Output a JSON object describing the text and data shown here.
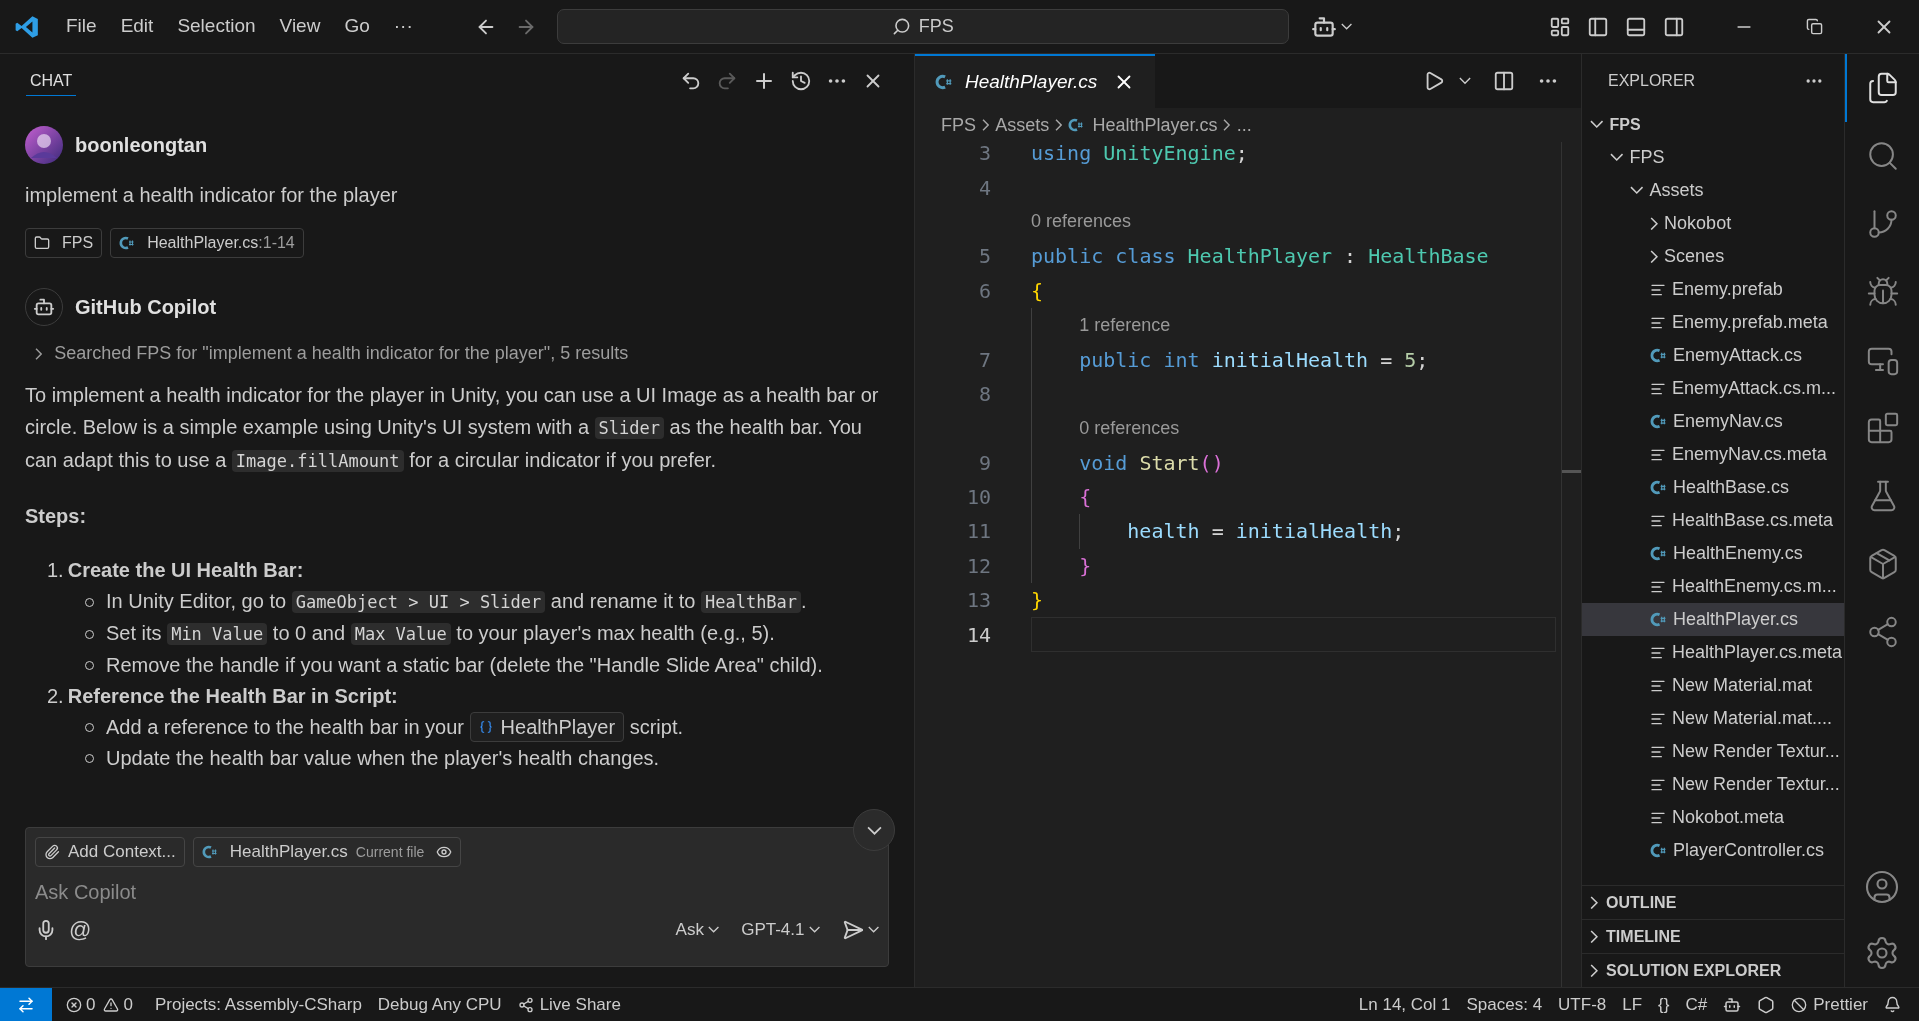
{
  "menu": [
    "File",
    "Edit",
    "Selection",
    "View",
    "Go",
    "···"
  ],
  "command_center": {
    "value": "FPS"
  },
  "chat": {
    "tab": {
      "label": "CHAT",
      "selected": true
    },
    "user": {
      "name": "boonleongtan",
      "message": "implement a health indicator for the player",
      "chips": [
        {
          "kind": "folder",
          "label": "FPS"
        },
        {
          "kind": "csharp",
          "label": "HealthPlayer.cs",
          "range": ":1-14"
        }
      ]
    },
    "assistant": {
      "name": "GitHub Copilot",
      "search_note": {
        "text": "Searched FPS for \"implement a health indicator for the player\", 5 results",
        "expanded": false
      },
      "paragraph": [
        {
          "kind": "text",
          "text": "To implement a health indicator for the player in Unity, you can use a UI Image as a health bar or circle. Below is a simple example using Unity's UI system with a "
        },
        {
          "kind": "code",
          "text": "Slider"
        },
        {
          "kind": "text",
          "text": " as the health bar. You can adapt this to use a "
        },
        {
          "kind": "code",
          "text": "Image.fillAmount"
        },
        {
          "kind": "text",
          "text": " for a circular indicator if you prefer."
        }
      ],
      "heading": "Steps:",
      "steps": [
        {
          "number": "1.",
          "title": "Create the UI Health Bar:",
          "bullets": [
            [
              {
                "kind": "text",
                "text": "In Unity Editor, go to "
              },
              {
                "kind": "code",
                "text": "GameObject > UI > Slider"
              },
              {
                "kind": "text",
                "text": " and rename it to "
              },
              {
                "kind": "code",
                "text": "HealthBar"
              },
              {
                "kind": "text",
                "text": "."
              }
            ],
            [
              {
                "kind": "text",
                "text": "Set its "
              },
              {
                "kind": "code",
                "text": "Min Value"
              },
              {
                "kind": "text",
                "text": " to 0 and "
              },
              {
                "kind": "code",
                "text": "Max Value"
              },
              {
                "kind": "text",
                "text": " to your player's max health (e.g., 5)."
              }
            ],
            [
              {
                "kind": "text",
                "text": "Remove the handle if you want a static bar (delete the \"Handle Slide Area\" child)."
              }
            ]
          ]
        },
        {
          "number": "2.",
          "title": "Reference the Health Bar in Script:",
          "bullets": [
            [
              {
                "kind": "text",
                "text": "Add a reference to the health bar in your "
              },
              {
                "kind": "symbol",
                "text": "HealthPlayer"
              },
              {
                "kind": "text",
                "text": " script."
              }
            ],
            [
              {
                "kind": "text",
                "text": "Update the health bar value when the player's health changes."
              }
            ]
          ]
        }
      ]
    },
    "input": {
      "add_context": "Add Context...",
      "file_chip": {
        "name": "HealthPlayer.cs",
        "note": "Current file"
      },
      "placeholder": "Ask Copilot",
      "at": "@",
      "mode": "Ask",
      "model": "GPT-4.1"
    }
  },
  "editor": {
    "tab": {
      "label": "HealthPlayer.cs",
      "selected": true
    },
    "breadcrumb": [
      {
        "kind": "text",
        "label": "FPS"
      },
      {
        "kind": "text",
        "label": "Assets"
      },
      {
        "kind": "csharp",
        "label": "HealthPlayer.cs"
      },
      {
        "kind": "text",
        "label": "..."
      }
    ],
    "lines": [
      {
        "number": "3",
        "current": false,
        "tokens": [
          {
            "kind": "keyword",
            "t": "using"
          },
          {
            "kind": "type",
            "t": "UnityEngine",
            "glue": false
          },
          {
            "kind": "punct",
            "t": ";",
            "glue": true
          }
        ]
      },
      {
        "number": "4",
        "current": false
      },
      {
        "number": "5",
        "current": false,
        "lens": "0 references",
        "tokens": [
          {
            "kind": "keyword",
            "t": "public"
          },
          {
            "kind": "keyword",
            "t": "class",
            "glue": false
          },
          {
            "kind": "type",
            "t": "HealthPlayer",
            "glue": false
          },
          {
            "kind": "punct",
            "t": ":",
            "glue": false
          },
          {
            "kind": "type",
            "t": "HealthBase",
            "glue": false
          }
        ]
      },
      {
        "number": "6",
        "current": false,
        "tokens": [
          {
            "kind": "open-brace1",
            "t": "{"
          }
        ]
      },
      {
        "number": "7",
        "current": false,
        "lens": "1 reference",
        "tokens": [
          {
            "kind": "keyword",
            "t": "public"
          },
          {
            "kind": "keyword",
            "t": "int",
            "glue": false
          },
          {
            "kind": "ident",
            "t": "initialHealth",
            "glue": false
          },
          {
            "kind": "punct",
            "t": "=",
            "glue": false
          },
          {
            "kind": "number",
            "t": "5",
            "glue": false
          },
          {
            "kind": "punct",
            "t": ";",
            "glue": true
          }
        ]
      },
      {
        "number": "8",
        "current": false
      },
      {
        "number": "9",
        "current": false,
        "lens": "0 references",
        "tokens": [
          {
            "kind": "keyword",
            "t": "void"
          },
          {
            "kind": "method",
            "t": "Start",
            "glue": false
          },
          {
            "kind": "paren2",
            "t": "()",
            "glue": true
          }
        ]
      },
      {
        "number": "10",
        "current": false,
        "tokens": [
          {
            "kind": "open-brace2",
            "t": "{"
          }
        ]
      },
      {
        "number": "11",
        "current": false,
        "tokens": [
          {
            "kind": "ident",
            "t": "health"
          },
          {
            "kind": "punct",
            "t": "=",
            "glue": false
          },
          {
            "kind": "ident",
            "t": "initialHealth",
            "glue": false
          },
          {
            "kind": "punct",
            "t": ";",
            "glue": true
          }
        ]
      },
      {
        "number": "12",
        "current": false,
        "tokens": [
          {
            "kind": "close-brace2",
            "t": "}"
          }
        ]
      },
      {
        "number": "13",
        "current": false,
        "tokens": [
          {
            "kind": "close-brace1",
            "t": "}"
          }
        ]
      },
      {
        "number": "14",
        "current": true
      }
    ]
  },
  "explorer": {
    "title": "EXPLORER",
    "tree": [
      {
        "label": "FPS",
        "kind": "root",
        "expanded": true,
        "selected": false,
        "children": [
          {
            "label": "FPS",
            "kind": "folder",
            "expanded": true,
            "selected": false,
            "children": [
              {
                "label": "Assets",
                "kind": "folder",
                "expanded": true,
                "selected": false,
                "children": [
                  {
                    "label": "Nokobot",
                    "kind": "folder",
                    "expanded": false,
                    "selected": false
                  },
                  {
                    "label": "Scenes",
                    "kind": "folder",
                    "expanded": false,
                    "selected": false
                  },
                  {
                    "label": "Enemy.prefab",
                    "kind": "text",
                    "selected": false
                  },
                  {
                    "label": "Enemy.prefab.meta",
                    "kind": "text",
                    "selected": false
                  },
                  {
                    "label": "EnemyAttack.cs",
                    "kind": "csharp",
                    "selected": false
                  },
                  {
                    "label": "EnemyAttack.cs.m...",
                    "kind": "text",
                    "selected": false
                  },
                  {
                    "label": "EnemyNav.cs",
                    "kind": "csharp",
                    "selected": false
                  },
                  {
                    "label": "EnemyNav.cs.meta",
                    "kind": "text",
                    "selected": false
                  },
                  {
                    "label": "HealthBase.cs",
                    "kind": "csharp",
                    "selected": false
                  },
                  {
                    "label": "HealthBase.cs.meta",
                    "kind": "text",
                    "selected": false
                  },
                  {
                    "label": "HealthEnemy.cs",
                    "kind": "csharp",
                    "selected": false
                  },
                  {
                    "label": "HealthEnemy.cs.m...",
                    "kind": "text",
                    "selected": false
                  },
                  {
                    "label": "HealthPlayer.cs",
                    "kind": "csharp",
                    "selected": true
                  },
                  {
                    "label": "HealthPlayer.cs.meta",
                    "kind": "text",
                    "selected": false
                  },
                  {
                    "label": "New Material.mat",
                    "kind": "text",
                    "selected": false
                  },
                  {
                    "label": "New Material.mat....",
                    "kind": "text",
                    "selected": false
                  },
                  {
                    "label": "New Render Textur...",
                    "kind": "text",
                    "selected": false
                  },
                  {
                    "label": "New Render Textur...",
                    "kind": "text",
                    "selected": false
                  },
                  {
                    "label": "Nokobot.meta",
                    "kind": "text",
                    "selected": false
                  },
                  {
                    "label": "PlayerController.cs",
                    "kind": "csharp",
                    "selected": false
                  }
                ]
              }
            ]
          }
        ]
      }
    ],
    "sections": [
      {
        "label": "OUTLINE",
        "expanded": false
      },
      {
        "label": "TIMELINE",
        "expanded": false
      },
      {
        "label": "SOLUTION EXPLORER",
        "expanded": false
      }
    ]
  },
  "activity_bar": [
    {
      "kind": "explorer",
      "selected": true
    },
    {
      "kind": "search",
      "selected": false
    },
    {
      "kind": "source-control",
      "selected": false
    },
    {
      "kind": "run-debug",
      "selected": false
    },
    {
      "kind": "remote",
      "selected": false
    },
    {
      "kind": "extensions",
      "selected": false
    },
    {
      "kind": "testing",
      "selected": false
    },
    {
      "kind": "package",
      "selected": false
    },
    {
      "kind": "share",
      "selected": false
    }
  ],
  "status_bar": {
    "errors": "0",
    "warnings": "0",
    "left": [
      {
        "kind": "plain",
        "label": "Projects: Assembly-CSharp"
      },
      {
        "kind": "plain",
        "label": "Debug Any CPU"
      },
      {
        "kind": "share",
        "label": "Live Share"
      }
    ],
    "right": [
      {
        "kind": "plain",
        "label": "Ln 14, Col 1"
      },
      {
        "kind": "plain",
        "label": "Spaces: 4"
      },
      {
        "kind": "plain",
        "label": "UTF-8"
      },
      {
        "kind": "plain",
        "label": "LF"
      },
      {
        "kind": "plain",
        "label": "{}"
      },
      {
        "kind": "plain",
        "label": "C#"
      },
      {
        "kind": "copilot"
      },
      {
        "kind": "csharp-kit"
      },
      {
        "kind": "blocked",
        "label": "Prettier"
      },
      {
        "kind": "bell"
      }
    ]
  }
}
